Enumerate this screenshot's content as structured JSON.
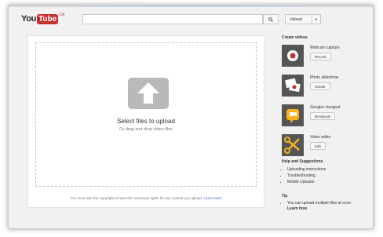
{
  "header": {
    "logo_you": "You",
    "logo_tube": "Tube",
    "logo_country": "CA",
    "search_placeholder": "",
    "upload_label": "Upload"
  },
  "main": {
    "select_title": "Select files to upload",
    "select_sub": "Or drag and drop video files",
    "copyright_text": "You must own the copyright or have the necessary rights for any content you upload.",
    "learn_more": "Learn more"
  },
  "sidebar": {
    "create_title": "Create videos",
    "items": [
      {
        "label": "Webcam capture",
        "button": "Record",
        "icon": "record-icon"
      },
      {
        "label": "Photo slideshow",
        "button": "Create",
        "icon": "photos-icon"
      },
      {
        "label": "Google+ hangout",
        "button": "Broadcast",
        "icon": "hangout-icon"
      },
      {
        "label": "Video editor",
        "button": "Edit",
        "icon": "scissors-icon"
      }
    ],
    "help_title": "Help and Suggestions",
    "help_links": [
      "Uploading instructions",
      "Troubleshooting",
      "Mobile Uploads"
    ],
    "tip_title": "Tip",
    "tip_text": "You can upload multiple files at once.",
    "tip_learn": "Learn how"
  },
  "colors": {
    "brand_red": "#c4302b",
    "link_blue": "#2a6fc9",
    "hangout_yellow": "#f3b320"
  }
}
